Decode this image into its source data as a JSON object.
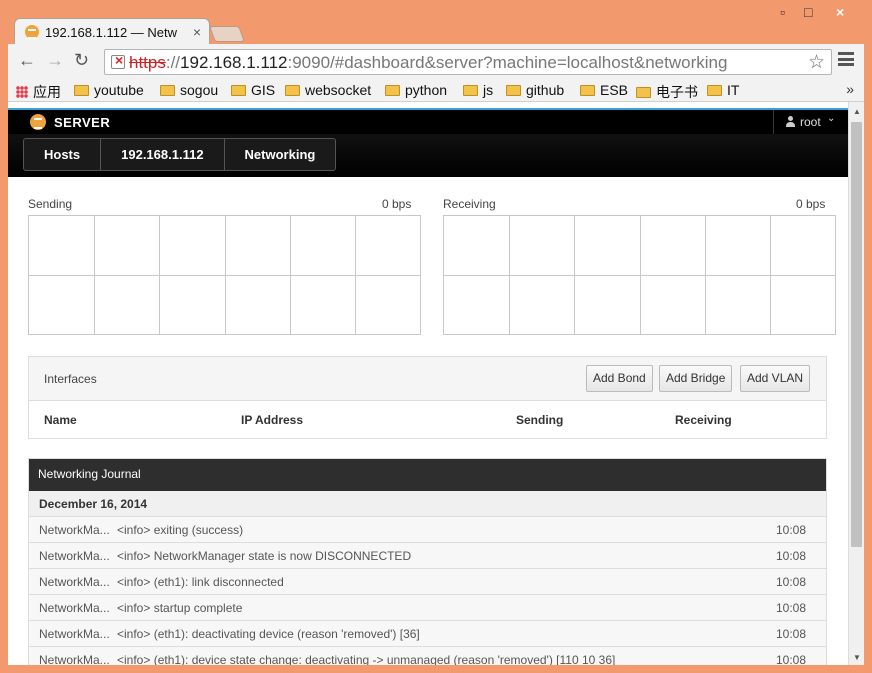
{
  "browser": {
    "tab_title": "192.168.1.112 — Netw",
    "tab_close": "×",
    "window_controls": {
      "minimize": "▫",
      "maximize": "□",
      "close": "×"
    },
    "url": {
      "scheme": "https",
      "host": "192.168.1.112",
      "rest": ":9090/#dashboard&server?machine=localhost&networking"
    },
    "nav": {
      "back": "←",
      "forward": "→",
      "reload": "↻",
      "star": "☆"
    },
    "bookmarks": [
      {
        "label": "应用",
        "type": "apps"
      },
      {
        "label": "youtube",
        "type": "folder"
      },
      {
        "label": "sogou",
        "type": "folder"
      },
      {
        "label": "GIS",
        "type": "folder"
      },
      {
        "label": "websocket",
        "type": "folder"
      },
      {
        "label": "python",
        "type": "folder"
      },
      {
        "label": "js",
        "type": "folder"
      },
      {
        "label": "github",
        "type": "folder"
      },
      {
        "label": "ESB",
        "type": "folder"
      },
      {
        "label": "电子书",
        "type": "folder"
      },
      {
        "label": "IT",
        "type": "folder"
      }
    ],
    "bookmarks_more": "»"
  },
  "app": {
    "brand": "SERVER",
    "user": "root",
    "user_caret": "⌄",
    "breadcrumbs": [
      "Hosts",
      "192.168.1.112",
      "Networking"
    ]
  },
  "graphs": {
    "sending": {
      "label": "Sending",
      "value": "0 bps"
    },
    "receiving": {
      "label": "Receiving",
      "value": "0 bps"
    }
  },
  "interfaces": {
    "title": "Interfaces",
    "buttons": {
      "add_bond": "Add Bond",
      "add_bridge": "Add Bridge",
      "add_vlan": "Add VLAN"
    },
    "columns": [
      "Name",
      "IP Address",
      "Sending",
      "Receiving"
    ]
  },
  "journal": {
    "title": "Networking Journal",
    "day": "December 16, 2014",
    "entries": [
      {
        "source": "NetworkMa...",
        "message": "<info> exiting (success)",
        "time": "10:08"
      },
      {
        "source": "NetworkMa...",
        "message": "<info> NetworkManager state is now DISCONNECTED",
        "time": "10:08"
      },
      {
        "source": "NetworkMa...",
        "message": "<info> (eth1): link disconnected",
        "time": "10:08"
      },
      {
        "source": "NetworkMa...",
        "message": "<info> startup complete",
        "time": "10:08"
      },
      {
        "source": "NetworkMa...",
        "message": "<info> (eth1): deactivating device (reason 'removed') [36]",
        "time": "10:08"
      },
      {
        "source": "NetworkMa...",
        "message": "<info> (eth1): device state change: deactivating -> unmanaged (reason 'removed') [110 10 36]",
        "time": "10:08"
      }
    ]
  },
  "scroll": {
    "up": "▲",
    "down": "▼"
  }
}
